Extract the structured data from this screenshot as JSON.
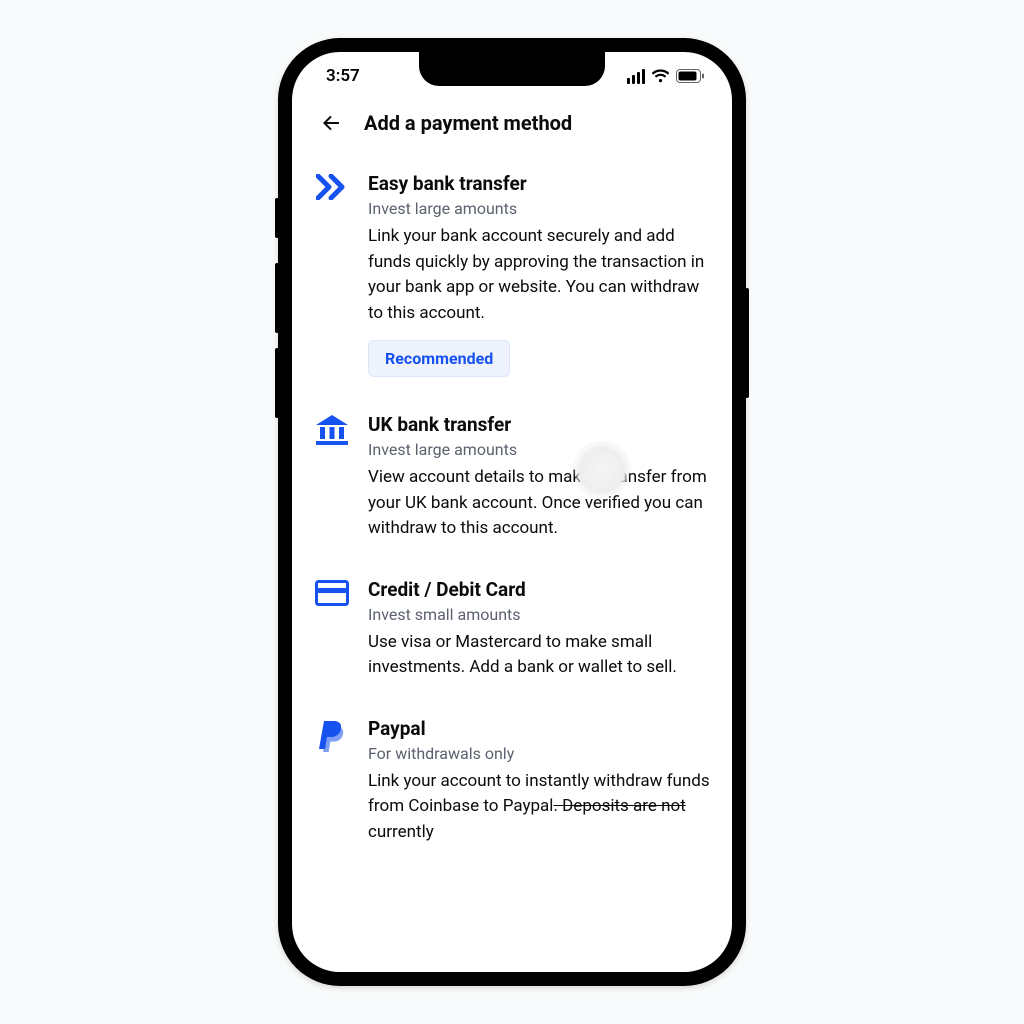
{
  "colors": {
    "accent": "#1652f0"
  },
  "status": {
    "time": "3:57"
  },
  "header": {
    "title": "Add a payment method"
  },
  "methods": [
    {
      "icon": "double-chevron-icon",
      "title": "Easy bank transfer",
      "subtitle": "Invest large amounts",
      "description": "Link your bank account securely and add funds quickly by approving the transaction in your bank app or website. You can withdraw to this account.",
      "badge": "Recommended"
    },
    {
      "icon": "bank-icon",
      "title": "UK bank transfer",
      "subtitle": "Invest large amounts",
      "description": "View account details to make a transfer from your UK bank account. Once verified you can withdraw to this account."
    },
    {
      "icon": "card-icon",
      "title": "Credit / Debit Card",
      "subtitle": "Invest small amounts",
      "description": "Use visa or Mastercard to make small investments. Add a bank or wallet to sell."
    },
    {
      "icon": "paypal-icon",
      "title": "Paypal",
      "subtitle": "For withdrawals only",
      "desc_pre": "Link your account to instantly withdraw funds from Coinbase to Paypal",
      "desc_strike": ". Deposits are not",
      "desc_post": " currently"
    }
  ]
}
